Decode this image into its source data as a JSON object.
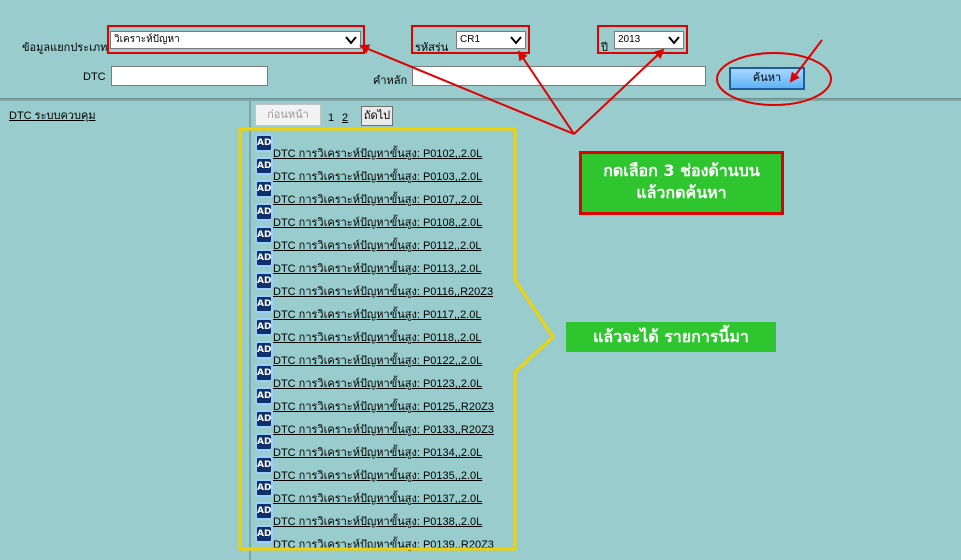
{
  "filters": {
    "category_label": "ข้อมูลแยกประเภท",
    "category_value": "วิเคราะห์ปัญหา",
    "model_label": "รหัสรุ่น",
    "model_value": "CR1",
    "year_label": "ปี",
    "year_value": "2013",
    "dtc_label": "DTC",
    "dtc_value": "",
    "keyword_label": "คำหลัก",
    "keyword_value": "",
    "search_button": "ค้นหา"
  },
  "sidebar": {
    "link_label": "DTC ระบบควบคุม"
  },
  "pagination": {
    "prev_label": "ก่อนหน้า",
    "pages": [
      "1",
      "2"
    ],
    "next_label": "ถัดไป"
  },
  "icon_text": "AD",
  "results": [
    "DTC การวิเคราะห์ปัญหาขั้นสูง: P0102,,2.0L",
    "DTC การวิเคราะห์ปัญหาขั้นสูง: P0103,,2.0L",
    "DTC การวิเคราะห์ปัญหาขั้นสูง: P0107,,2.0L",
    "DTC การวิเคราะห์ปัญหาขั้นสูง: P0108,,2.0L",
    "DTC การวิเคราะห์ปัญหาขั้นสูง: P0112,,2.0L",
    "DTC การวิเคราะห์ปัญหาขั้นสูง: P0113,,2.0L",
    "DTC การวิเคราะห์ปัญหาขั้นสูง: P0116,,R20Z3",
    "DTC การวิเคราะห์ปัญหาขั้นสูง: P0117,,2.0L",
    "DTC การวิเคราะห์ปัญหาขั้นสูง: P0118,,2.0L",
    "DTC การวิเคราะห์ปัญหาขั้นสูง: P0122,,2.0L",
    "DTC การวิเคราะห์ปัญหาขั้นสูง: P0123,,2.0L",
    "DTC การวิเคราะห์ปัญหาขั้นสูง: P0125,,R20Z3",
    "DTC การวิเคราะห์ปัญหาขั้นสูง: P0133,,R20Z3",
    "DTC การวิเคราะห์ปัญหาขั้นสูง: P0134,,2.0L",
    "DTC การวิเคราะห์ปัญหาขั้นสูง: P0135,,2.0L",
    "DTC การวิเคราะห์ปัญหาขั้นสูง: P0137,,2.0L",
    "DTC การวิเคราะห์ปัญหาขั้นสูง: P0138,,2.0L",
    "DTC การวิเคราะห์ปัญหาขั้นสูง: P0139,,R20Z3"
  ],
  "annotations": {
    "instruction_line1": "กดเลือก 3 ช่องด้านบน",
    "instruction_line2": "แล้วกดค้นหา",
    "result_note": "แล้วจะได้ รายการนี้มา"
  },
  "colors": {
    "background": "#99cccc",
    "annotation_red": "#e00000",
    "annotation_yellow": "#f2d200",
    "annotation_green": "#2ec52e"
  }
}
